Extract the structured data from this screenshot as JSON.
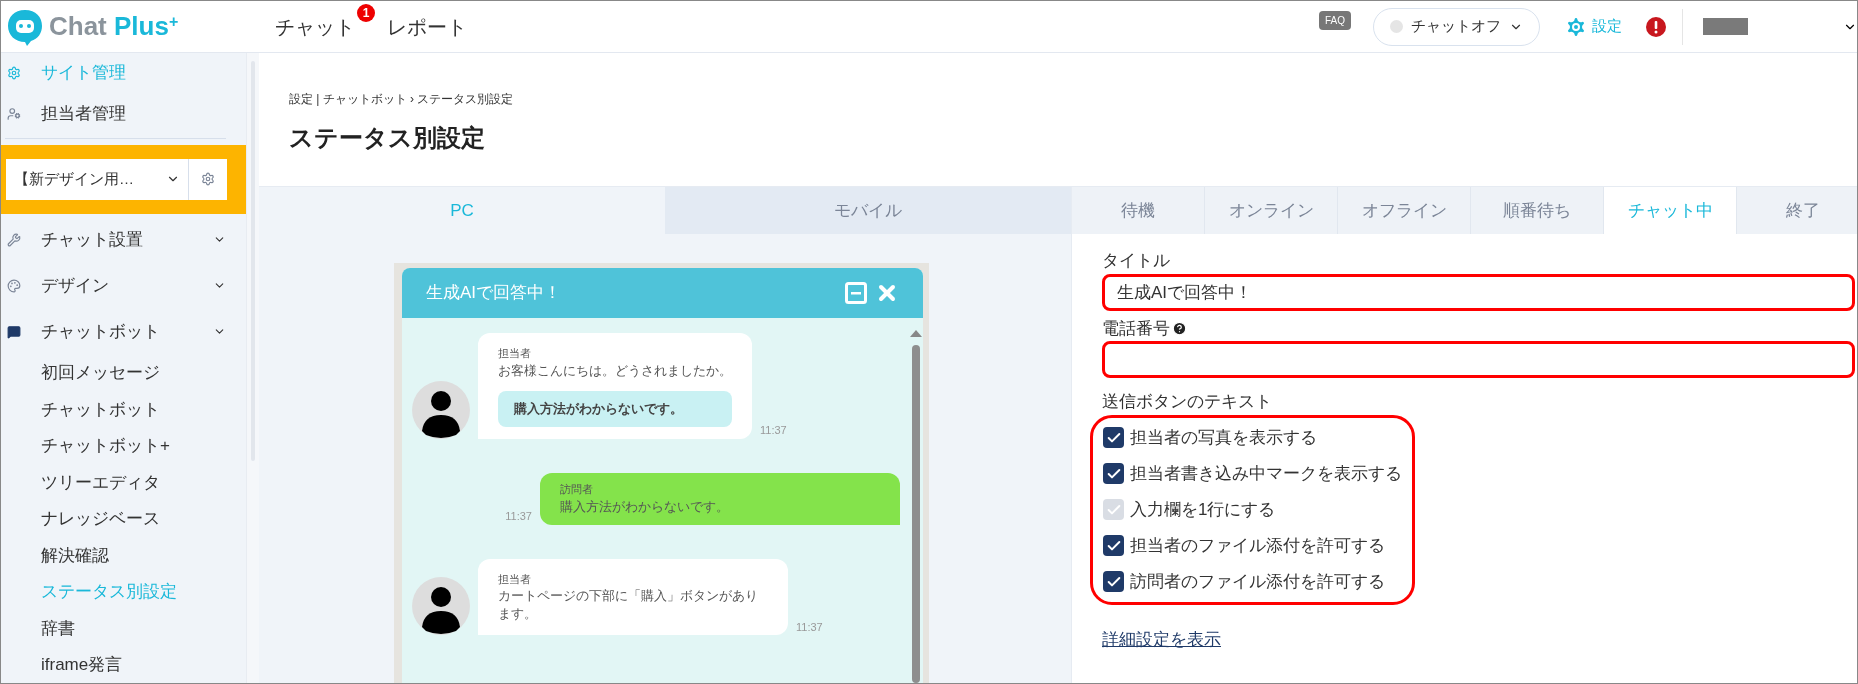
{
  "logo": {
    "word": "Chat",
    "accent": "Plus",
    "mark": "+"
  },
  "nav": [
    {
      "label": "チャット",
      "badge": "1"
    },
    {
      "label": "レポート"
    }
  ],
  "topbar": {
    "faq": "FAQ",
    "status": {
      "label": "チャットオフ",
      "online": false
    },
    "settings": "設定"
  },
  "sidebar": {
    "items": [
      {
        "label": "サイト管理",
        "selected": true
      },
      {
        "label": "担当者管理",
        "selected": false
      }
    ],
    "site_select": {
      "value": "【新デザイン用…"
    },
    "menu": [
      {
        "label": "チャット設置",
        "selected": false
      },
      {
        "label": "デザイン",
        "selected": false
      },
      {
        "label": "チャットボット",
        "selected": false,
        "children": [
          {
            "label": "初回メッセージ",
            "selected": false
          },
          {
            "label": "チャットボット",
            "selected": false
          },
          {
            "label": "チャットボット+",
            "selected": false
          },
          {
            "label": "ツリーエディタ",
            "selected": false
          },
          {
            "label": "ナレッジベース",
            "selected": false
          },
          {
            "label": "解決確認",
            "selected": false
          },
          {
            "label": "ステータス別設定",
            "selected": true
          },
          {
            "label": "辞書",
            "selected": false
          },
          {
            "label": "iframe発言",
            "selected": false
          }
        ]
      }
    ]
  },
  "page": {
    "breadcrumb": "設定 | チャットボット › ステータス別設定",
    "title": "ステータス別設定"
  },
  "device_tabs": [
    {
      "label": "PC",
      "selected": true
    },
    {
      "label": "モバイル",
      "selected": false
    }
  ],
  "status_tabs": [
    {
      "label": "待機",
      "selected": false
    },
    {
      "label": "オンライン",
      "selected": false
    },
    {
      "label": "オフライン",
      "selected": false
    },
    {
      "label": "順番待ち",
      "selected": false
    },
    {
      "label": "チャット中",
      "selected": true
    },
    {
      "label": "終了",
      "selected": false
    }
  ],
  "preview": {
    "title": "生成AIで回答中！",
    "messages": [
      {
        "kind": "agent",
        "name": "担当者",
        "text": "お客様こんにちは。どうされましたか。",
        "option": "購入方法がわからないです。",
        "time": "11:37"
      },
      {
        "kind": "visitor",
        "name": "訪問者",
        "text": "購入方法がわからないです。",
        "time": "11:37"
      },
      {
        "kind": "agent",
        "name": "担当者",
        "text": "カートページの下部に「購入」ボタンがあります。",
        "time": "11:37"
      }
    ]
  },
  "form": {
    "fields": [
      {
        "label": "タイトル",
        "value": "生成AIで回答中！",
        "help": false,
        "highlighted": true
      },
      {
        "label": "電話番号",
        "help": true,
        "highlighted": true
      }
    ],
    "options_label": "送信ボタンのテキスト",
    "options": [
      {
        "label": "担当者の写真を表示する",
        "checked": true,
        "disabled": false
      },
      {
        "label": "担当者書き込み中マークを表示する",
        "checked": true,
        "disabled": false
      },
      {
        "label": "入力欄を1行にする",
        "checked": true,
        "disabled": true
      },
      {
        "label": "担当者のファイル添付を許可する",
        "checked": true,
        "disabled": false
      },
      {
        "label": "訪問者のファイル添付を許可する",
        "checked": true,
        "disabled": false
      }
    ],
    "options_highlighted": true,
    "details_link": "詳細設定を表示"
  }
}
